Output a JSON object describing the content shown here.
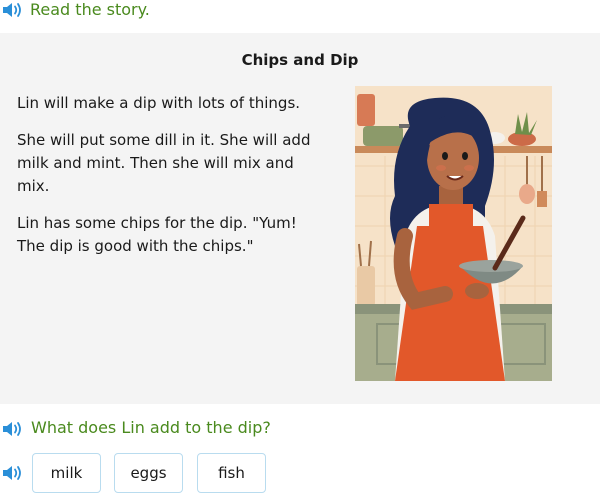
{
  "instruction": {
    "text": "Read the story.",
    "icon": "speaker-icon"
  },
  "story": {
    "title": "Chips and Dip",
    "paragraphs": [
      "Lin will make a dip with lots of things.",
      "She will put some dill in it. She will add milk and mint. Then she will mix and mix.",
      "Lin has some chips for the dip. \"Yum! The dip is good with the chips.\""
    ]
  },
  "question": {
    "text": "What does Lin add to the dip?",
    "icon": "speaker-icon"
  },
  "choices": [
    {
      "label": "milk"
    },
    {
      "label": "eggs"
    },
    {
      "label": "fish"
    }
  ],
  "colors": {
    "accent_green": "#4a8a1e",
    "speaker_blue": "#2a8fd8",
    "choice_border": "#b9dcef",
    "panel_bg": "#f4f4f4"
  }
}
